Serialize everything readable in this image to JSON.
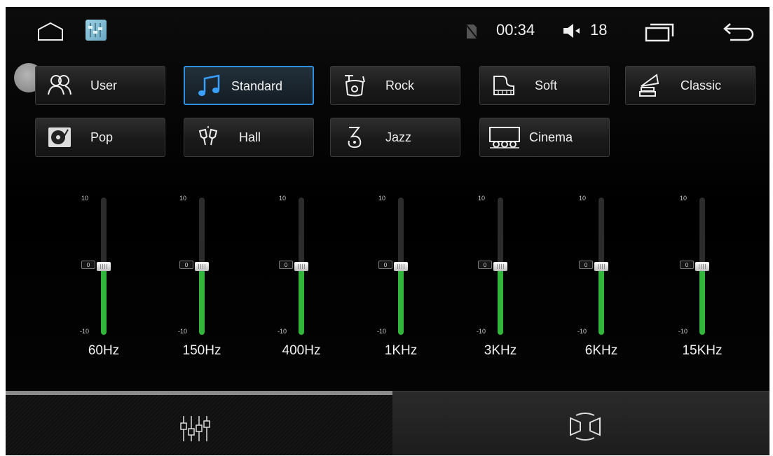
{
  "status": {
    "time": "00:34",
    "volume": "18",
    "icons": [
      "home-icon",
      "equalizer-app-icon",
      "no-sim-icon",
      "volume-icon",
      "recent-apps-icon",
      "back-icon"
    ]
  },
  "presets": [
    {
      "label": "User",
      "icon": "people-icon",
      "active": false
    },
    {
      "label": "Standard",
      "icon": "music-note-icon",
      "active": true
    },
    {
      "label": "Rock",
      "icon": "drum-icon",
      "active": false
    },
    {
      "label": "Soft",
      "icon": "piano-icon",
      "active": false
    },
    {
      "label": "Classic",
      "icon": "gramophone-icon",
      "active": false
    },
    {
      "label": "Pop",
      "icon": "turntable-icon",
      "active": false
    },
    {
      "label": "Hall",
      "icon": "cheers-icon",
      "active": false
    },
    {
      "label": "Jazz",
      "icon": "saxophone-icon",
      "active": false
    },
    {
      "label": "Cinema",
      "icon": "cinema-icon",
      "active": false
    }
  ],
  "eq": {
    "max_label": "10",
    "min_label": "-10",
    "zero_label": "0",
    "range": [
      -10,
      10
    ],
    "bands": [
      {
        "freq": "60Hz",
        "value": 0
      },
      {
        "freq": "150Hz",
        "value": 0
      },
      {
        "freq": "400Hz",
        "value": 0
      },
      {
        "freq": "1KHz",
        "value": 0
      },
      {
        "freq": "3KHz",
        "value": 0
      },
      {
        "freq": "6KHz",
        "value": 0
      },
      {
        "freq": "15KHz",
        "value": 0
      }
    ]
  },
  "tabs": [
    {
      "icon": "equalizer-sliders-icon",
      "active": true
    },
    {
      "icon": "speaker-balance-icon",
      "active": false
    }
  ],
  "colors": {
    "accent": "#2d8fe0",
    "level": "#31b53a"
  }
}
